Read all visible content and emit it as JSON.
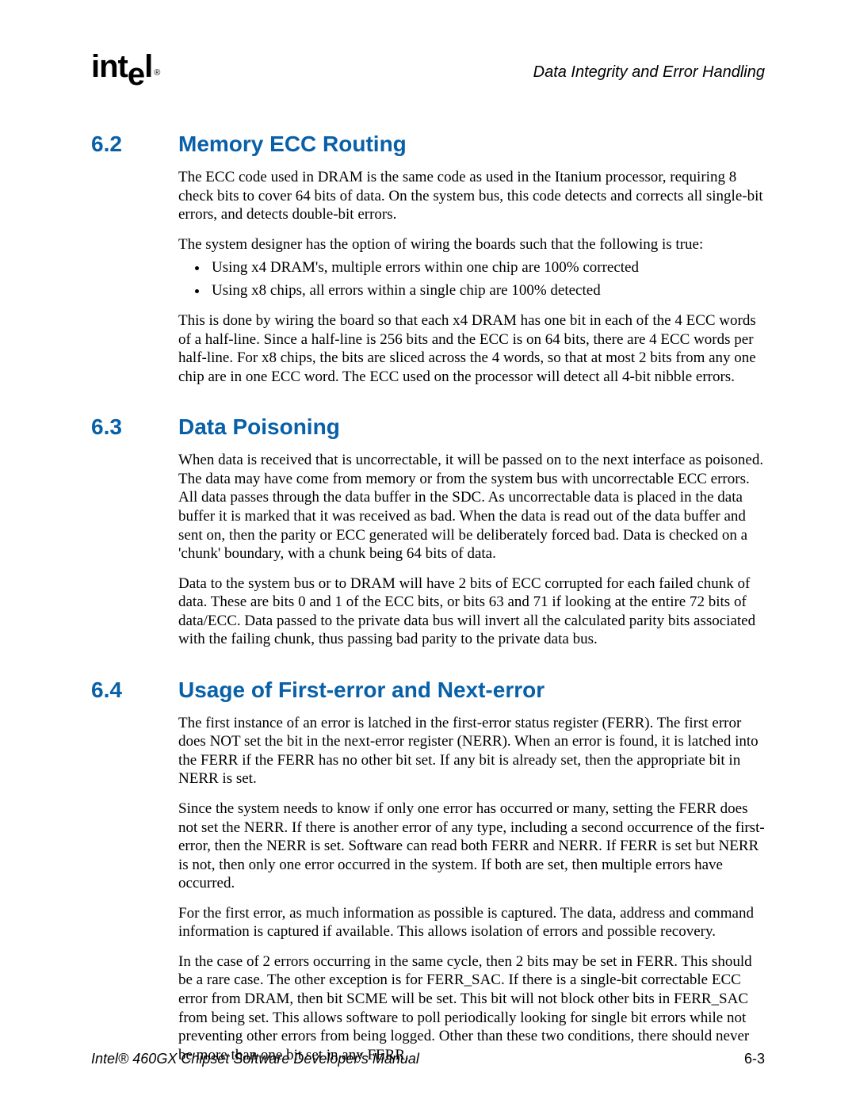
{
  "header": {
    "logo_text": "intel",
    "logo_reg": "®",
    "chapter_title": "Data Integrity and Error Handling"
  },
  "sections": {
    "s62": {
      "num": "6.2",
      "title": "Memory ECC Routing",
      "p1": "The ECC code used in DRAM is the same code as used in the  Itanium processor, requiring 8 check bits to cover 64 bits of data. On the system bus, this code detects and corrects all single-bit errors, and detects double-bit errors.",
      "p2": "The system designer has the option of wiring the boards such that the following is true:",
      "li1": "Using x4 DRAM's, multiple errors within one chip are 100% corrected",
      "li2": "Using x8 chips, all errors within a single chip are 100% detected",
      "p3": "This is done by wiring the board so that each x4 DRAM has one bit in each of the 4 ECC words of a half-line. Since a half-line is 256 bits and the ECC is on 64 bits, there are 4 ECC words per half-line. For x8 chips, the bits are sliced across the 4 words, so that at most 2 bits from any one chip are in one ECC word. The ECC used on the processor will detect all 4-bit nibble errors."
    },
    "s63": {
      "num": "6.3",
      "title": "Data Poisoning",
      "p1": "When data is received that is uncorrectable, it will be passed on to the next interface as poisoned. The data may have come from memory or from the system bus with uncorrectable ECC errors. All data passes through the data buffer in the SDC. As uncorrectable data is placed in the data buffer it is marked that it was received as bad. When the data is read out of the data buffer and sent on, then the parity or ECC generated will be deliberately forced bad. Data is checked on a 'chunk' boundary, with a chunk being 64 bits of data.",
      "p2": "Data to the system bus or to DRAM will have 2 bits of ECC corrupted for each failed chunk of data. These are bits 0 and 1 of the ECC bits, or bits 63 and 71 if looking at the entire 72 bits of data/ECC. Data passed to the private data bus will invert all the calculated parity bits associated with the failing chunk, thus passing bad parity to the private data bus."
    },
    "s64": {
      "num": "6.4",
      "title": "Usage of First-error and Next-error",
      "p1": "The first instance of an error is latched in the first-error status register (FERR). The first error does NOT set the bit in the next-error register (NERR). When an error is found, it is latched into the FERR if the FERR has no other bit set. If any bit is already set, then the appropriate bit in NERR is set.",
      "p2": "Since the system needs to know if only one error has occurred or many, setting the FERR does not set the NERR. If there is another error of any type, including a second occurrence of the first-error, then the NERR is set. Software can read both FERR and NERR. If FERR is set but NERR is not, then only one error occurred in the system. If both are set, then multiple errors have occurred.",
      "p3": "For the first error, as much information as possible is captured. The data, address and command information is captured if available. This allows isolation of errors and possible recovery.",
      "p4": "In the case of 2 errors occurring in the same cycle, then 2 bits may be set in FERR. This should be a rare case. The other exception is for FERR_SAC. If there is a single-bit correctable ECC error from DRAM, then bit SCME will be set. This bit will not block other bits in FERR_SAC from being set. This allows software to poll periodically looking for single bit errors while not preventing other errors from being logged. Other than these two conditions, there should never be more than one bit set in any FERR."
    }
  },
  "footer": {
    "doc_title": "Intel® 460GX Chipset Software Developer's Manual",
    "page_num": "6-3"
  }
}
